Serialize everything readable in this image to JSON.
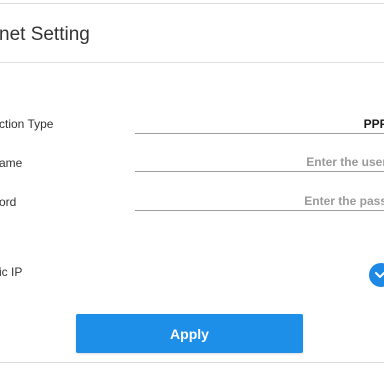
{
  "header": {
    "title": "net Setting"
  },
  "form": {
    "connection_type": {
      "label": "ction Type",
      "value": "PPF"
    },
    "username": {
      "label": "ame",
      "placeholder": "Enter the user"
    },
    "password": {
      "label": "ord",
      "placeholder": "Enter the pass"
    },
    "dynamic_ip": {
      "label": "ic IP",
      "icon": "chevron-down-icon"
    }
  },
  "actions": {
    "apply_label": "Apply"
  },
  "colors": {
    "accent": "#1e88e5",
    "button": "#1e8fe8"
  }
}
